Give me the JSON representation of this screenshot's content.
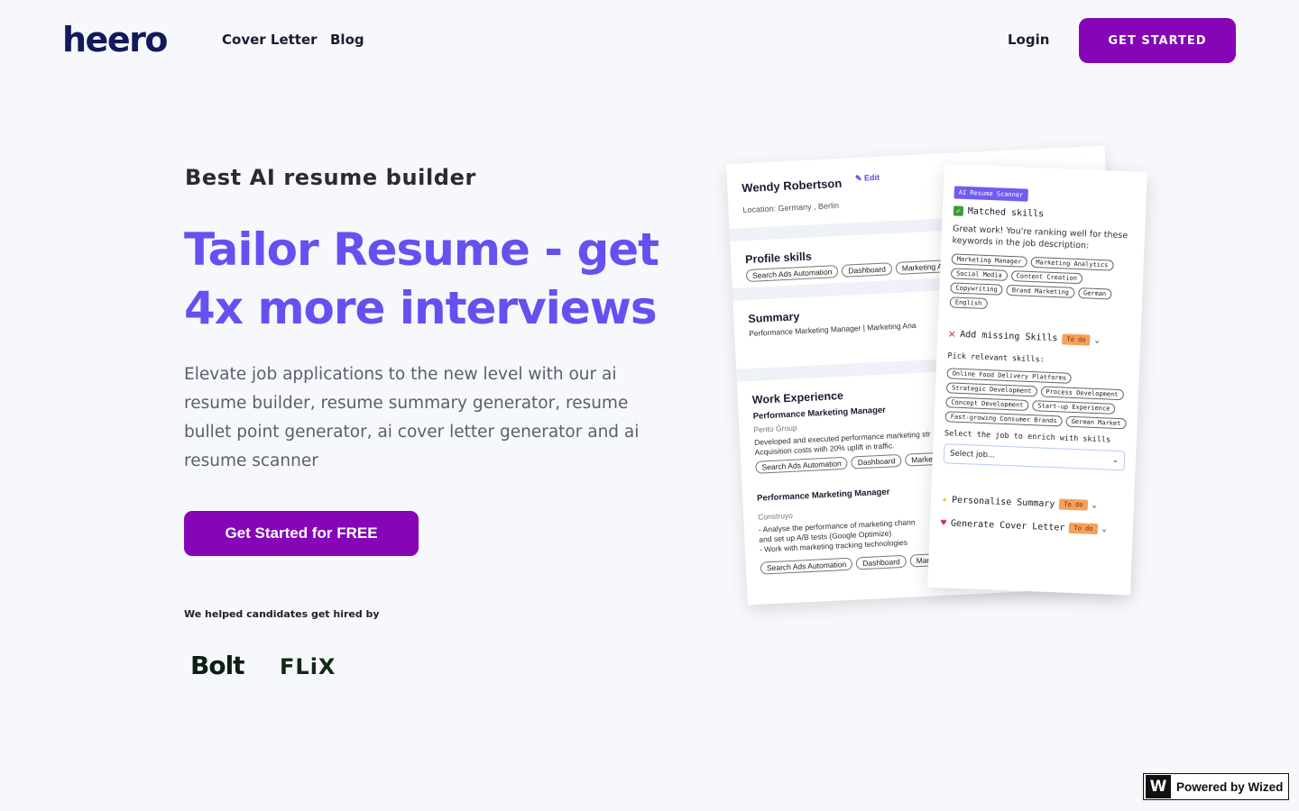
{
  "nav": {
    "logo": "heero",
    "links": [
      "Cover Letter",
      "Blog"
    ],
    "login": "Login",
    "cta": "GET STARTED"
  },
  "hero": {
    "eyebrow": "Best AI resume builder",
    "headline": "Tailor Resume - get 4x more interviews",
    "description": "Elevate job applications to the new level with our ai resume builder, resume summary generator, resume bullet point generator, ai cover letter generator and ai resume scanner",
    "cta": "Get Started for FREE",
    "helped": "We helped candidates get hired by",
    "logos": [
      "Bolt",
      "FLiX"
    ]
  },
  "resume": {
    "name": "Wendy Robertson",
    "edit": "Edit",
    "location": "Location: Germany , Berlin",
    "profile_skills_title": "Profile skills",
    "profile_skills": [
      "Search Ads Automation",
      "Dashboard",
      "Marketing Ana"
    ],
    "summary_title": "Summary",
    "summary_text": "Performance Marketing Manager | Marketing Ana",
    "work_title": "Work Experience",
    "jobs": [
      {
        "title": "Performance Marketing Manager",
        "company": "Pento Group",
        "lines": [
          "Developed and executed performance marketing str",
          "Acquisition costs with 20% uplift in traffic."
        ],
        "tags": [
          "Search Ads Automation",
          "Dashboard",
          "Marketing"
        ]
      },
      {
        "title": "Performance Marketing Manager",
        "company": "Construyo",
        "lines": [
          "- Analyse the performance of marketing chann",
          "and set up A/B tests (Google Optimize)",
          "- Work with marketing tracking technologies"
        ],
        "tags": [
          "Search Ads Automation",
          "Dashboard",
          "Marketi"
        ]
      }
    ]
  },
  "scanner": {
    "badge": "AI Resume Scanner",
    "matched": "Matched skills",
    "great": "Great work! You're ranking well for these keywords in the job description:",
    "matched_chips": [
      "Marketing Manager",
      "Marketing Analytics",
      "Social Media",
      "Content Creation",
      "Copywriting",
      "Brand Marketing",
      "German",
      "English"
    ],
    "missing": "Add missing Skills",
    "todo": "To do",
    "pick": "Pick relevant skills:",
    "pick_chips": [
      "Online Food Delivery Platforms",
      "Strategic Development",
      "Process Development",
      "Concept Development",
      "Start-up Experience",
      "Fast-growing Consumer Brands",
      "German Market"
    ],
    "select_label": "Select the job to enrich with skills",
    "select_placeholder": "Select job...",
    "personalise": "Personalise Summary",
    "cover": "Generate Cover Letter"
  },
  "badge": {
    "icon": "W",
    "text": "Powered by Wized"
  }
}
